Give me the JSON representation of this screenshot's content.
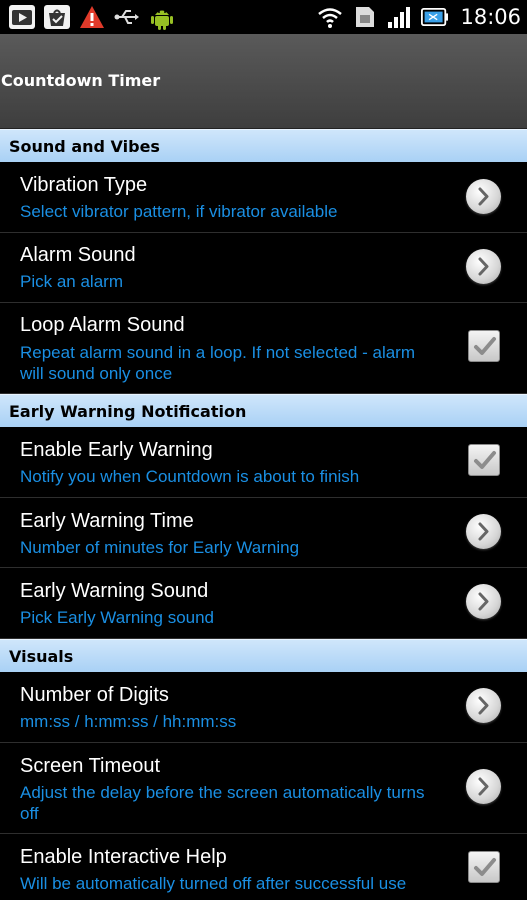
{
  "status_bar": {
    "time": "18:06",
    "icons": [
      "youtube-icon",
      "bag-check-icon",
      "warning-icon",
      "usb-icon",
      "android-icon",
      "wifi-icon",
      "sim-icon",
      "signal-icon",
      "battery-icon"
    ]
  },
  "title": "Countdown Timer",
  "sections": [
    {
      "header": "Sound and Vibes",
      "items": [
        {
          "title": "Vibration Type",
          "summary": "Select vibrator pattern, if vibrator available",
          "widget": "arrow"
        },
        {
          "title": "Alarm Sound",
          "summary": "Pick an alarm",
          "widget": "arrow"
        },
        {
          "title": "Loop Alarm Sound",
          "summary": "Repeat alarm sound in a loop. If not selected - alarm will sound only once",
          "widget": "checkbox",
          "checked": true
        }
      ]
    },
    {
      "header": "Early Warning Notification",
      "items": [
        {
          "title": "Enable Early Warning",
          "summary": "Notify you when Countdown is about to finish",
          "widget": "checkbox",
          "checked": true
        },
        {
          "title": "Early Warning Time",
          "summary": "Number of minutes for Early Warning",
          "widget": "arrow"
        },
        {
          "title": "Early Warning Sound",
          "summary": "Pick Early Warning sound",
          "widget": "arrow"
        }
      ]
    },
    {
      "header": "Visuals",
      "items": [
        {
          "title": "Number of Digits",
          "summary": "mm:ss / h:mm:ss / hh:mm:ss",
          "widget": "arrow"
        },
        {
          "title": "Screen Timeout",
          "summary": "Adjust the delay before the screen automatically turns off",
          "widget": "arrow"
        },
        {
          "title": "Enable Interactive Help",
          "summary": "Will be automatically turned off after successful use",
          "widget": "checkbox",
          "checked": true
        }
      ]
    }
  ],
  "colors": {
    "section_header": "#a9d1f5",
    "summary_text": "#1a8fe3",
    "background": "#000000"
  }
}
